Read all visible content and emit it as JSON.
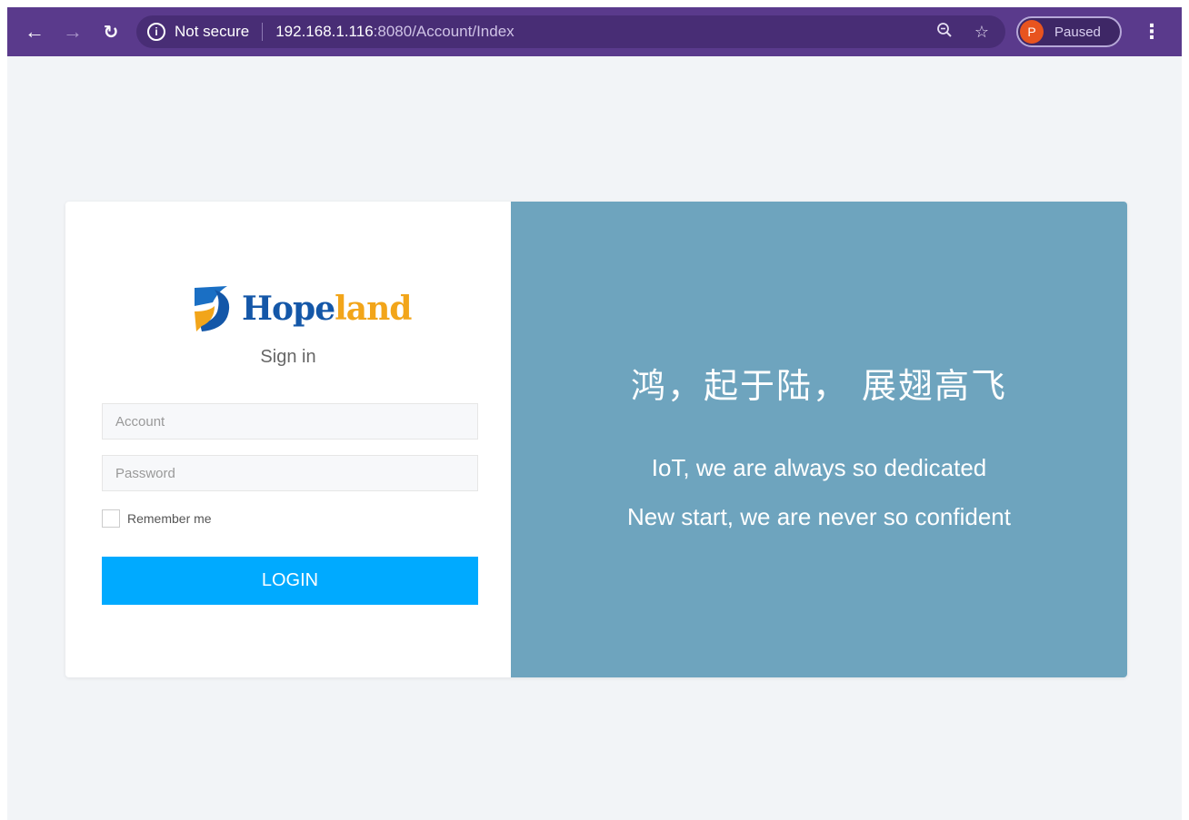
{
  "browser": {
    "security_label": "Not secure",
    "url_host": "192.168.1.116",
    "url_path": ":8080/Account/Index",
    "profile_initial": "P",
    "profile_status": "Paused",
    "icons": [
      "back-arrow-icon",
      "forward-arrow-icon",
      "reload-icon",
      "info-icon",
      "zoom-icon",
      "star-icon",
      "menu-icon"
    ]
  },
  "login": {
    "logo_text_hope": "Hope",
    "logo_text_land": "land",
    "heading": "Sign in",
    "account_placeholder": "Account",
    "password_placeholder": "Password",
    "remember_label": "Remember me",
    "button_label": "LOGIN"
  },
  "promo": {
    "slogan_cn": "鸿，起于陆， 展翅高飞",
    "line1": "IoT, we are always so dedicated",
    "line2": "New start, we are never so confident"
  },
  "colors": {
    "chrome": "#5a3a8c",
    "accent_button": "#00aaff",
    "promo_panel": "#6ea4be",
    "page_bg": "#f2f4f7",
    "logo_blue": "#1457a8",
    "logo_orange": "#f2a51a"
  }
}
